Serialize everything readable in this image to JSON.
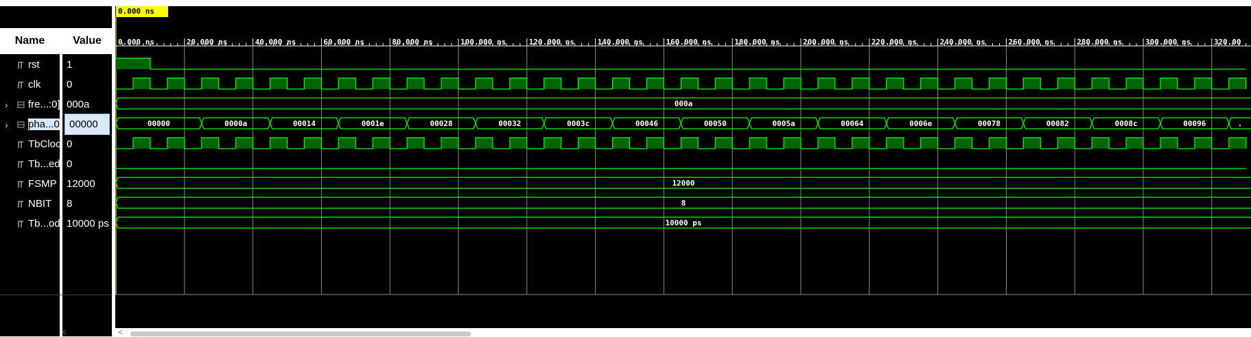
{
  "columns": {
    "name": "Name",
    "value": "Value"
  },
  "cursor": {
    "time_label": "0.000 ns"
  },
  "time_axis": {
    "ticks": [
      "0.000 ns",
      "20.000 ns",
      "40.000 ns",
      "60.000 ns",
      "80.000 ns",
      "100.000 ns",
      "120.000 ns",
      "140.000 ns",
      "160.000 ns",
      "180.000 ns",
      "200.000 ns",
      "220.000 ns",
      "240.000 ns",
      "260.000 ns",
      "280.000 ns",
      "300.000 ns",
      "320.00"
    ],
    "tick_step_ns": 20,
    "visible_range_ns": [
      0,
      330
    ]
  },
  "signals": [
    {
      "name": "rst",
      "value": "1",
      "kind": "bit",
      "expandable": false,
      "icon": "bit-signal-icon",
      "wave": {
        "type": "bit",
        "transitions": [
          [
            0,
            1
          ],
          [
            10,
            0
          ]
        ]
      }
    },
    {
      "name": "clk",
      "value": "0",
      "kind": "bit",
      "expandable": false,
      "icon": "bit-signal-icon",
      "wave": {
        "type": "clock",
        "period_ns": 10,
        "initial": 0
      }
    },
    {
      "name": "fre...:0]",
      "value": "000a",
      "kind": "bus",
      "expandable": true,
      "icon": "bus-signal-icon",
      "wave": {
        "type": "bus",
        "segments": [
          {
            "start": 0,
            "label": "000a"
          }
        ]
      }
    },
    {
      "name": "pha...0",
      "value": "00000",
      "kind": "bus",
      "expandable": true,
      "selected": true,
      "icon": "bus-signal-selected-icon",
      "wave": {
        "type": "bus",
        "segments": [
          {
            "start": 0,
            "label": "00000"
          },
          {
            "start": 25,
            "label": "0000a"
          },
          {
            "start": 45,
            "label": "00014"
          },
          {
            "start": 65,
            "label": "0001e"
          },
          {
            "start": 85,
            "label": "00028"
          },
          {
            "start": 105,
            "label": "00032"
          },
          {
            "start": 125,
            "label": "0003c"
          },
          {
            "start": 145,
            "label": "00046"
          },
          {
            "start": 165,
            "label": "00050"
          },
          {
            "start": 185,
            "label": "0005a"
          },
          {
            "start": 205,
            "label": "00064"
          },
          {
            "start": 225,
            "label": "0006e"
          },
          {
            "start": 245,
            "label": "00078"
          },
          {
            "start": 265,
            "label": "00082"
          },
          {
            "start": 285,
            "label": "0008c"
          },
          {
            "start": 305,
            "label": "00096"
          },
          {
            "start": 325,
            "label": "."
          }
        ]
      }
    },
    {
      "name": "TbCloc",
      "value": "0",
      "kind": "bit",
      "expandable": false,
      "icon": "bit-signal-icon",
      "wave": {
        "type": "clock",
        "period_ns": 10,
        "initial": 0
      }
    },
    {
      "name": "Tb...ed",
      "value": "0",
      "kind": "bit",
      "expandable": false,
      "icon": "bit-signal-icon",
      "wave": {
        "type": "bit",
        "transitions": [
          [
            0,
            0
          ]
        ]
      }
    },
    {
      "name": "FSMP",
      "value": "12000",
      "kind": "param",
      "expandable": false,
      "icon": "bit-signal-icon",
      "wave": {
        "type": "bus",
        "segments": [
          {
            "start": 0,
            "label": "12000"
          }
        ]
      }
    },
    {
      "name": "NBIT",
      "value": "8",
      "kind": "param",
      "expandable": false,
      "icon": "bit-signal-icon",
      "wave": {
        "type": "bus",
        "segments": [
          {
            "start": 0,
            "label": "8"
          }
        ]
      }
    },
    {
      "name": "Tb...od",
      "value": "10000 ps",
      "kind": "param",
      "expandable": false,
      "icon": "bit-signal-icon",
      "wave": {
        "type": "bus",
        "segments": [
          {
            "start": 0,
            "label": "10000 ps"
          }
        ]
      }
    }
  ],
  "colors": {
    "wave": "#00ff00",
    "wave_fill": "#006400",
    "grid": "#8a8a8a",
    "background": "#000000",
    "cursor_label_bg": "#ffff00",
    "cursor_line": "#ffff00",
    "tick_label": "#ffffff",
    "bus_text": "#ffffff"
  }
}
